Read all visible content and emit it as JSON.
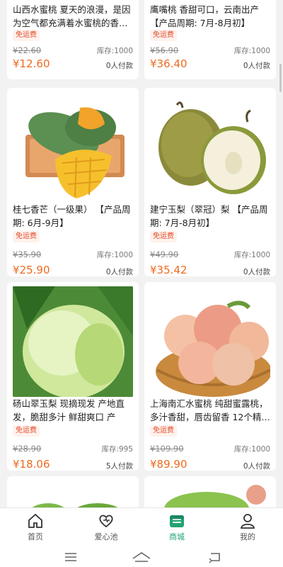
{
  "products": [
    {
      "title": "山西水蜜桃 夏天的浪漫，是因为空气都充满着水蜜桃的香…",
      "badge": "免运费",
      "old_price": "¥22.60",
      "stock": "库存:1000",
      "price": "¥12.60",
      "paid": "0人付款"
    },
    {
      "title": "鹰嘴桃 香甜可口，云南出产 【产品周期: 7月-8月初】",
      "badge": "免运费",
      "old_price": "¥56.90",
      "stock": "库存:1000",
      "price": "¥36.40",
      "paid": "0人付款"
    },
    {
      "title": "桂七香芒（一级果） 【产品周期: 6月-9月】",
      "badge": "免运费",
      "old_price": "¥35.90",
      "stock": "库存:1000",
      "price": "¥25.90",
      "paid": "0人付款"
    },
    {
      "title": "建宁玉梨（翠冠）梨 【产品周期: 7月-8月初】",
      "badge": "免运费",
      "old_price": "¥49.90",
      "stock": "库存:1000",
      "price": "¥35.42",
      "paid": "0人付款"
    },
    {
      "title": "砀山翠玉梨 现摘现发 产地直发，脆甜多汁 鲜甜爽口 产品…",
      "badge": "免运费",
      "old_price": "¥28.90",
      "stock": "库存:995",
      "price": "¥18.06",
      "paid": "5人付款"
    },
    {
      "title": "上海南汇水蜜桃 纯甜蜜露桃，多汁香甜，唇齿留香 12个精…",
      "badge": "免运费",
      "old_price": "¥109.90",
      "stock": "库存:1000",
      "price": "¥89.90",
      "paid": "0人付款"
    }
  ],
  "tabs": [
    {
      "label": "首页"
    },
    {
      "label": "爱心池"
    },
    {
      "label": "商城"
    },
    {
      "label": "我的"
    }
  ],
  "colors": {
    "accent": "#22a374",
    "price": "#ee6a1f",
    "badge": "#e14c2a"
  },
  "icons": [
    "home-icon",
    "heart-icon",
    "shop-icon",
    "user-icon",
    "menu-icon",
    "home-nav-icon",
    "back-icon"
  ]
}
